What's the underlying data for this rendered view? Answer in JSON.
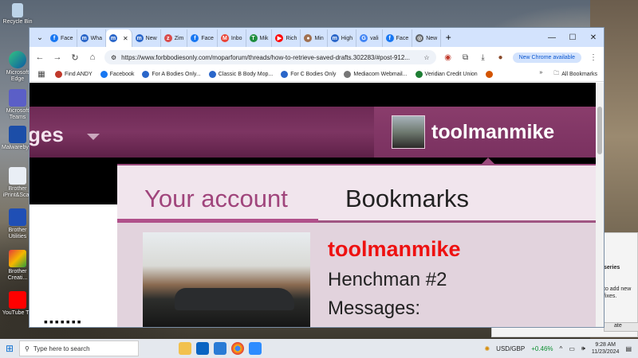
{
  "desktop": {
    "icons": [
      {
        "label": "Recycle Bin"
      },
      {
        "label": "Microsoft Edge"
      },
      {
        "label": "Microsoft Teams"
      },
      {
        "label": "Malwarebytes"
      },
      {
        "label": "Brother iPrint&Scan"
      },
      {
        "label": "Brother Utilities"
      },
      {
        "label": "Brother Creati..."
      },
      {
        "label": "YouTube TV"
      }
    ]
  },
  "browser": {
    "tabs": [
      {
        "label": "Face"
      },
      {
        "label": "Wha"
      },
      {
        "label": ""
      },
      {
        "label": "New"
      },
      {
        "label": "Zim"
      },
      {
        "label": "Face"
      },
      {
        "label": "Inbo"
      },
      {
        "label": "Mik"
      },
      {
        "label": "Rich"
      },
      {
        "label": "Min"
      },
      {
        "label": "High"
      },
      {
        "label": "vali"
      },
      {
        "label": "Face"
      },
      {
        "label": "New"
      }
    ],
    "new_tab": "+",
    "url": "https://www.forbbodiesonly.com/moparforum/threads/how-to-retrieve-saved-drafts.302283/#post-912...",
    "new_chrome_label": "New Chrome available",
    "bookmarks": [
      "Find ANDY",
      "Facebook",
      "For A Bodies Only...",
      "Classic B Body Mop...",
      "For C Bodies Only",
      "Mediacom Webmail...",
      "Veridian Credit Union"
    ],
    "bookmarks_more": "»",
    "all_bookmarks": "All Bookmarks"
  },
  "site": {
    "nav_partial": "ges",
    "username": "toolmanmike",
    "dropdown": {
      "tabs": [
        "Your account",
        "Bookmarks"
      ],
      "account_name": "toolmanmike",
      "account_title": "Henchman #2",
      "messages_label": "Messages:"
    },
    "dots": "▪▪▪▪▪▪▪"
  },
  "notification": {
    "title": "series",
    "body": "to add new fixes.",
    "button": "ate"
  },
  "taskbar": {
    "search_placeholder": "Type here to search",
    "ticker": "USD/GBP",
    "ticker_change": "+0.46%",
    "time": "9:28 AM",
    "date": "11/23/2024"
  }
}
